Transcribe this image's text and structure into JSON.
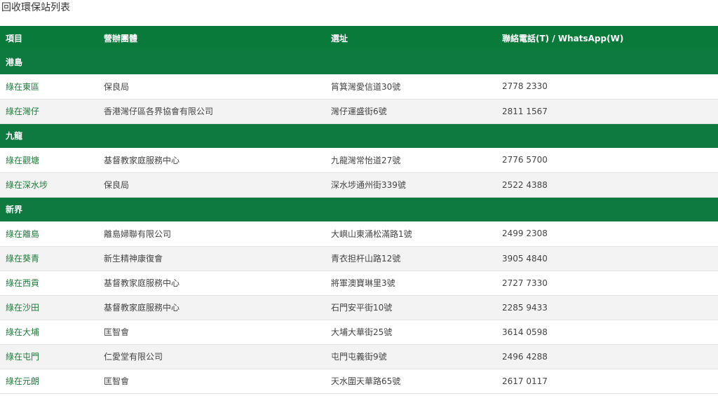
{
  "page": {
    "title": "回收環保站列表"
  },
  "table": {
    "headers": [
      "項目",
      "營辦團體",
      "選址",
      "聯絡電話(T) / WhatsApp(W)"
    ],
    "regions": [
      {
        "name": "港島",
        "rows": [
          {
            "item": "綠在東區",
            "operator": "保良局",
            "address": "筲箕灣愛信道30號",
            "phone": "2778 2330"
          },
          {
            "item": "綠在灣仔",
            "operator": "香港灣仔區各界協會有限公司",
            "address": "灣仔運盛街6號",
            "phone": "2811 1567"
          }
        ]
      },
      {
        "name": "九龍",
        "rows": [
          {
            "item": "綠在觀塘",
            "operator": "基督教家庭服務中心",
            "address": "九龍灣常怡道27號",
            "phone": "2776 5700"
          },
          {
            "item": "綠在深水埗",
            "operator": "保良局",
            "address": "深水埗通州街339號",
            "phone": "2522 4388"
          }
        ]
      },
      {
        "name": "新界",
        "rows": [
          {
            "item": "綠在離島",
            "operator": "離島婦聯有限公司",
            "address": "大嶼山東涌松滿路1號",
            "phone": "2499 2308"
          },
          {
            "item": "綠在葵青",
            "operator": "新生精神康復會",
            "address": "青衣担杆山路12號",
            "phone": "3905 4840"
          },
          {
            "item": "綠在西貢",
            "operator": "基督教家庭服務中心",
            "address": "將軍澳寶琳里3號",
            "phone": "2727 7330"
          },
          {
            "item": "綠在沙田",
            "operator": "基督教家庭服務中心",
            "address": "石門安平街10號",
            "phone": "2285 9433"
          },
          {
            "item": "綠在大埔",
            "operator": "匡智會",
            "address": "大埔大華街25號",
            "phone": "3614 0598"
          },
          {
            "item": "綠在屯門",
            "operator": "仁愛堂有限公司",
            "address": "屯門屯義街9號",
            "phone": "2496 4288"
          },
          {
            "item": "綠在元朗",
            "operator": "匡智會",
            "address": "天水圍天華路65號",
            "phone": "2617 0117"
          }
        ]
      }
    ]
  }
}
